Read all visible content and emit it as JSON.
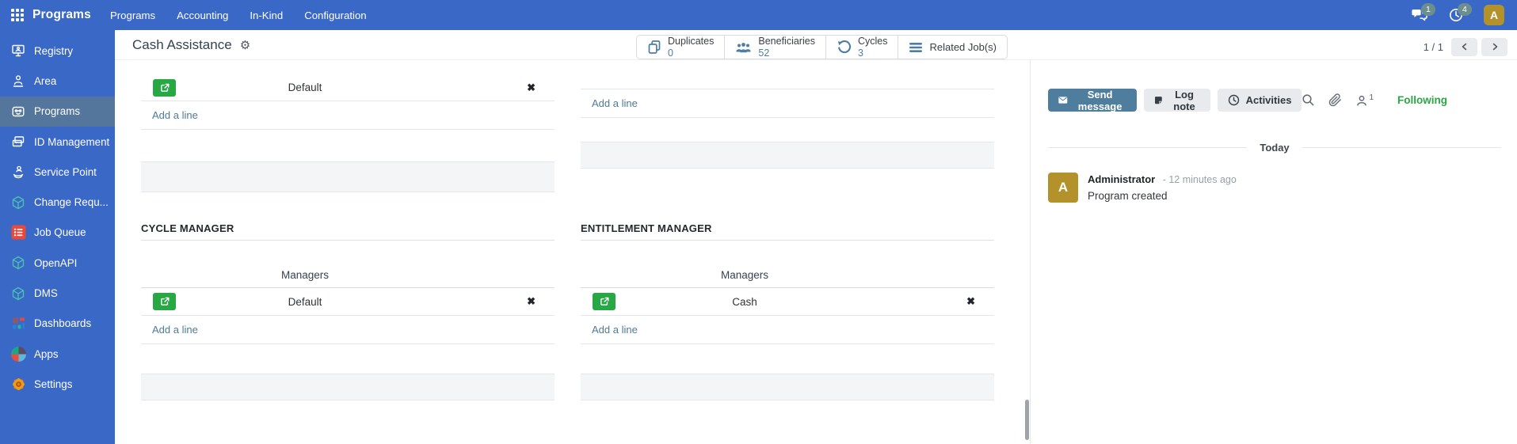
{
  "colors": {
    "navbar_blue": "#3a68c6",
    "sidebar_selected_blue": "#54769d",
    "steel_blue": "#4f7da1",
    "link_blue": "#4e7b94",
    "action_green": "#28a745",
    "following_green": "#28a745",
    "avatar_gold": "#b3922c",
    "job_queue_red": "#e8493a"
  },
  "navbar": {
    "app_name": "Programs",
    "menus": [
      "Programs",
      "Accounting",
      "In-Kind",
      "Configuration"
    ],
    "messages_badge": "1",
    "activities_badge": "4",
    "avatar_initial": "A"
  },
  "sidebar": {
    "items": [
      {
        "label": "Registry",
        "icon": "registry-icon"
      },
      {
        "label": "Area",
        "icon": "area-icon"
      },
      {
        "label": "Programs",
        "icon": "programs-icon",
        "selected": true
      },
      {
        "label": "ID Management",
        "icon": "id-management-icon"
      },
      {
        "label": "Service Point",
        "icon": "service-point-icon"
      },
      {
        "label": "Change Requ...",
        "icon": "cube-icon"
      },
      {
        "label": "Job Queue",
        "icon": "job-queue-icon"
      },
      {
        "label": "OpenAPI",
        "icon": "cube-icon"
      },
      {
        "label": "DMS",
        "icon": "cube-icon"
      },
      {
        "label": "Dashboards",
        "icon": "dashboards-icon"
      },
      {
        "label": "Apps",
        "icon": "apps-icon"
      },
      {
        "label": "Settings",
        "icon": "settings-icon"
      }
    ]
  },
  "header": {
    "title": "Cash Assistance",
    "stat_buttons": [
      {
        "label": "Duplicates",
        "value": "0",
        "icon": "duplicates-icon"
      },
      {
        "label": "Beneficiaries",
        "value": "52",
        "icon": "beneficiaries-icon"
      },
      {
        "label": "Cycles",
        "value": "3",
        "icon": "cycles-icon"
      },
      {
        "label": "Related Job(s)",
        "value": "",
        "icon": "related-jobs-icon"
      }
    ],
    "pager": {
      "counter": "1 / 1"
    }
  },
  "form": {
    "delete_glyph": "✖",
    "top_left_table": {
      "rows": [
        {
          "name": "Default"
        }
      ],
      "add_line": "Add a line"
    },
    "top_right_table": {
      "add_line": "Add a line"
    },
    "sections": [
      {
        "title": "CYCLE MANAGER",
        "column_header": "Managers",
        "rows": [
          {
            "name": "Default"
          }
        ],
        "add_line": "Add a line"
      },
      {
        "title": "ENTITLEMENT MANAGER",
        "column_header": "Managers",
        "rows": [
          {
            "name": "Cash"
          }
        ],
        "add_line": "Add a line"
      }
    ]
  },
  "chatter": {
    "send_message": "Send message",
    "log_note": "Log note",
    "activities": "Activities",
    "follower_count": "1",
    "following": "Following",
    "date_divider": "Today",
    "messages": [
      {
        "avatar_initial": "A",
        "author": "Administrator",
        "time_ago": "- 12 minutes ago",
        "body": "Program created"
      }
    ]
  }
}
